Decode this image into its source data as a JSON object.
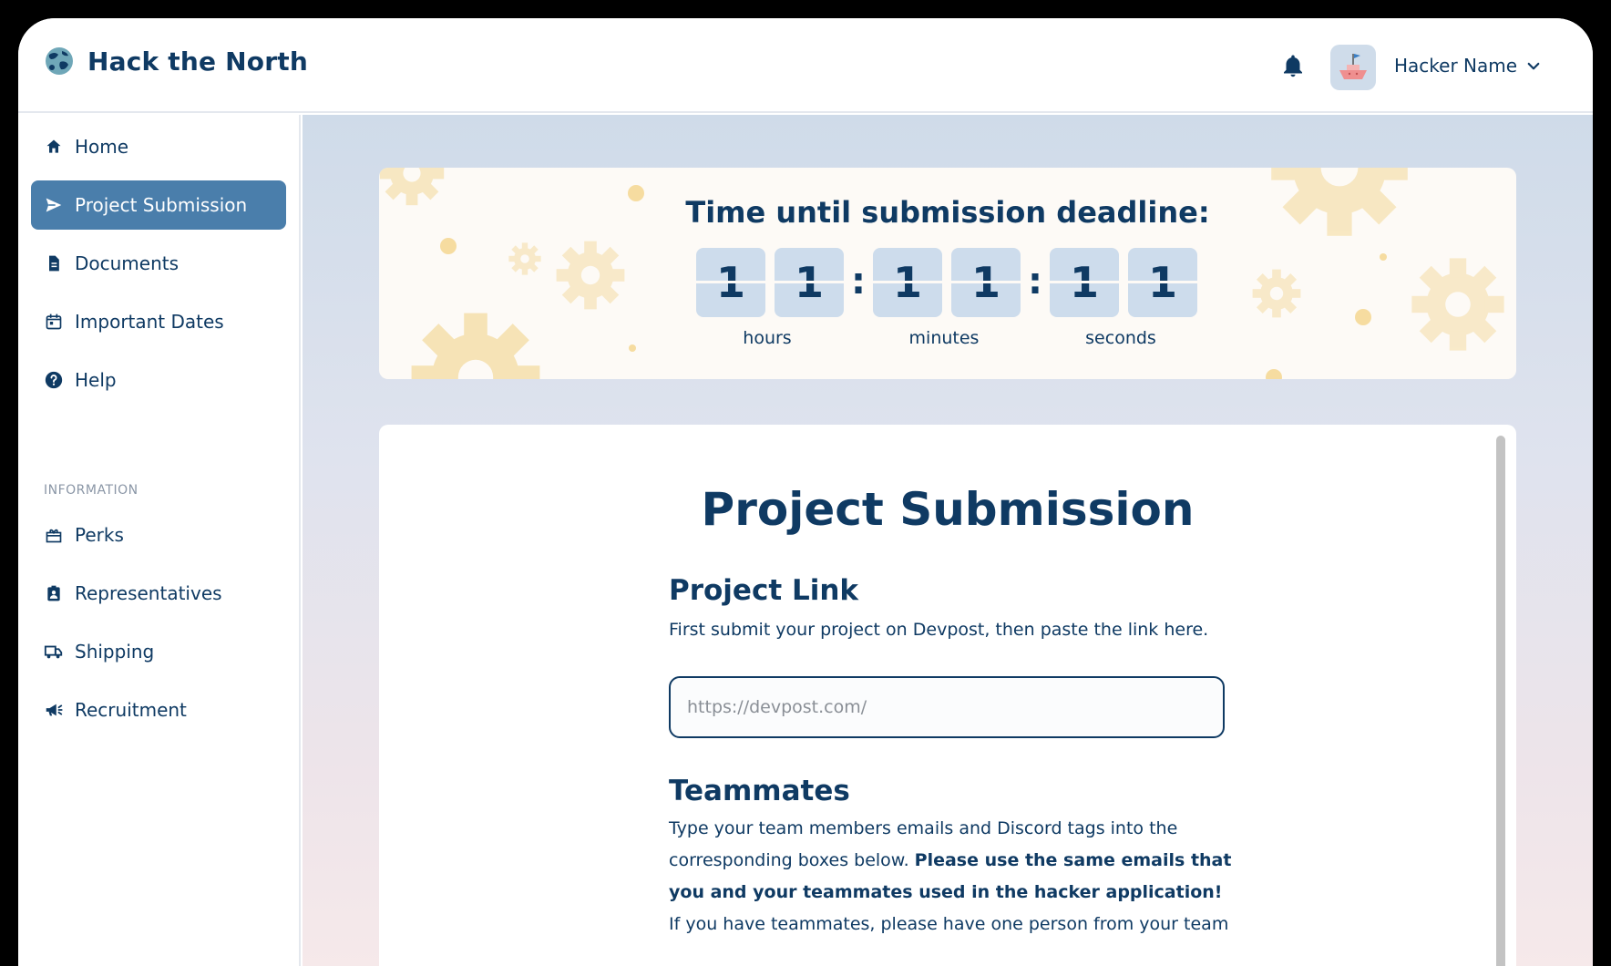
{
  "header": {
    "app_title": "Hack the North",
    "user_name": "Hacker Name"
  },
  "sidebar": {
    "items": [
      {
        "label": "Home",
        "icon": "home-icon"
      },
      {
        "label": "Project Submission",
        "icon": "send-icon",
        "active": true
      },
      {
        "label": "Documents",
        "icon": "document-icon"
      },
      {
        "label": "Important Dates",
        "icon": "calendar-icon"
      },
      {
        "label": "Help",
        "icon": "help-icon"
      }
    ],
    "section_label": "INFORMATION",
    "info_items": [
      {
        "label": "Perks",
        "icon": "gift-icon"
      },
      {
        "label": "Representatives",
        "icon": "badge-icon"
      },
      {
        "label": "Shipping",
        "icon": "truck-icon"
      },
      {
        "label": "Recruitment",
        "icon": "megaphone-icon"
      }
    ]
  },
  "timer": {
    "title": "Time until submission deadline:",
    "digits": [
      "1",
      "1",
      "1",
      "1",
      "1",
      "1"
    ],
    "separator": ":",
    "units": [
      "hours",
      "minutes",
      "seconds"
    ]
  },
  "form": {
    "title": "Project Submission",
    "link_heading": "Project Link",
    "link_description": "First submit your project on Devpost, then paste the link here.",
    "link_placeholder": "https://devpost.com/",
    "teammates_heading": "Teammates",
    "teammates_text_1": "Type your team members emails and Discord tags into the corresponding boxes below. ",
    "teammates_text_bold": "Please use the same emails that you and your teammates used in the hacker application!",
    "teammates_text_2": "If you have teammates, please have one person from your team"
  },
  "colors": {
    "primary": "#0f3a63",
    "active_nav": "#4a7eab",
    "digit_bg": "#cddcec",
    "gear": "#f6e3b6"
  }
}
